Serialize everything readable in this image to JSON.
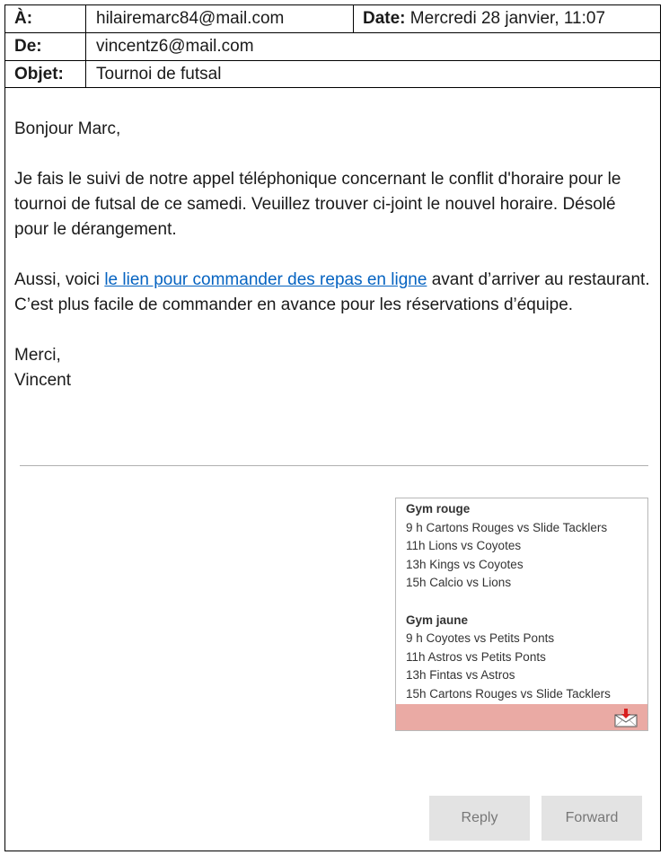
{
  "header": {
    "to_label": "À:",
    "to_value": "hilairemarc84@mail.com",
    "date_label": "Date:",
    "date_value": "Mercredi 28 janvier, 11:07",
    "from_label": "De:",
    "from_value": "vincentz6@mail.com",
    "subject_label": "Objet:",
    "subject_value": "Tournoi de futsal"
  },
  "body": {
    "greeting": "Bonjour Marc,",
    "paragraph1": "Je fais le suivi de notre appel téléphonique concernant le conflit d'horaire pour le tournoi de futsal de ce samedi. Veuillez trouver ci-joint le nouvel horaire. Désolé pour le dérangement.",
    "paragraph2_before": "Aussi, voici ",
    "paragraph2_link": "le lien pour commander des repas en ligne",
    "paragraph2_after": " avant d’arriver au restaurant. C’est plus facile de commander en avance pour les réservations d’équipe.",
    "closing": "Merci,",
    "signature": "Vincent"
  },
  "attachment": {
    "section1_title": "Gym rouge",
    "section1_lines": [
      "9 h Cartons Rouges vs Slide Tacklers",
      "11h Lions vs Coyotes",
      "13h Kings vs Coyotes",
      "15h Calcio vs Lions"
    ],
    "section2_title": "Gym jaune",
    "section2_lines": [
      "9 h Coyotes vs Petits Ponts",
      "11h Astros vs Petits Ponts",
      "13h Fintas vs Astros",
      "15h Cartons Rouges vs Slide Tacklers"
    ],
    "bar_color": "#eaaaa4",
    "download_icon": "envelope-download-icon"
  },
  "actions": {
    "reply_label": "Reply",
    "forward_label": "Forward"
  },
  "colors": {
    "link": "#0563c1",
    "button_bg": "#e3e3e3",
    "button_text": "#777777"
  }
}
